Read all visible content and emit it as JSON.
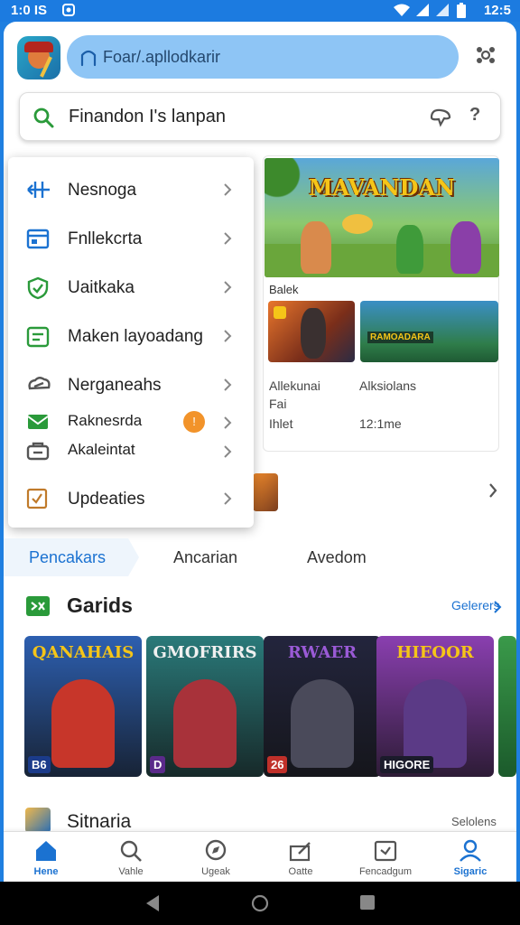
{
  "status_bar": {
    "time_left": "1:0 IS",
    "time_right": "12:5"
  },
  "header": {
    "url_text": "Foar/.apllodkarir"
  },
  "search": {
    "text": "Finandon I's lanpan",
    "help": "?"
  },
  "menu": {
    "items": [
      {
        "label": "Nesnoga",
        "icon": "grid-icon",
        "color": "#1b72d1"
      },
      {
        "label": "Fnllekcrta",
        "icon": "calendar-icon",
        "color": "#1b72d1"
      },
      {
        "label": "Uaitkaka",
        "icon": "shield-check-icon",
        "color": "#2a9a3a"
      },
      {
        "label": "Maken layoadang",
        "icon": "list-icon",
        "color": "#2a9a3a"
      },
      {
        "label": "Nerganeahs",
        "icon": "cloud-icon",
        "color": "#555555"
      },
      {
        "label": "Raknesrda",
        "icon": "mail-icon",
        "color": "#2a9a3a",
        "badge": "!"
      },
      {
        "label": "Akaleintat",
        "icon": "bag-icon",
        "color": "#555555"
      },
      {
        "label": "Updeaties",
        "icon": "update-icon",
        "color": "#c07a2a"
      }
    ]
  },
  "featured": {
    "hero_title": "MAVANDAN",
    "label": "Balek",
    "thumb2_title": "RAMOADARA",
    "meta": [
      {
        "line1": "Allekunai",
        "line2": "Fai",
        "line3": "Ihlet"
      },
      {
        "line1": "Alksiolans",
        "line3": "12:1me"
      }
    ]
  },
  "tabs": [
    "Pencakars",
    "Ancarian",
    "Avedom"
  ],
  "games_section": {
    "title": "Garids",
    "see_all": "Gelerers"
  },
  "game_cards": [
    {
      "title": "QANAHAIS",
      "badge": "B6",
      "bg": "#2d5fb0",
      "char_color": "#c7362a",
      "title_color": "#f5c518"
    },
    {
      "title": "GMOFRIRS",
      "badge": "D",
      "bg": "#2a7a7a",
      "char_color": "#a8323a",
      "title_color": "#f0f0f0"
    },
    {
      "title": "RWAER",
      "badge": "26",
      "bg": "#23253d",
      "char_color": "#4a4a5a",
      "title_color": "#9a5ad6"
    },
    {
      "title": "HIEOOR",
      "badge": "HIGORE",
      "bg": "#8a3fb0",
      "char_color": "#5b3a86",
      "title_color": "#f5c518"
    }
  ],
  "section2": {
    "title": "Sitnaria",
    "more": "Selolens"
  },
  "bottom_nav": [
    {
      "label": "Hene",
      "icon": "home-icon",
      "active": true
    },
    {
      "label": "Vahle",
      "icon": "search-icon"
    },
    {
      "label": "Ugeak",
      "icon": "explore-icon"
    },
    {
      "label": "Oatte",
      "icon": "edit-icon"
    },
    {
      "label": "Fencadgum",
      "icon": "inbox-icon"
    },
    {
      "label": "Sigaric",
      "icon": "profile-icon",
      "active": true
    }
  ],
  "colors": {
    "accent": "#1b72d1",
    "status_bar": "#1c7be0",
    "pill": "#8ec5f5"
  }
}
